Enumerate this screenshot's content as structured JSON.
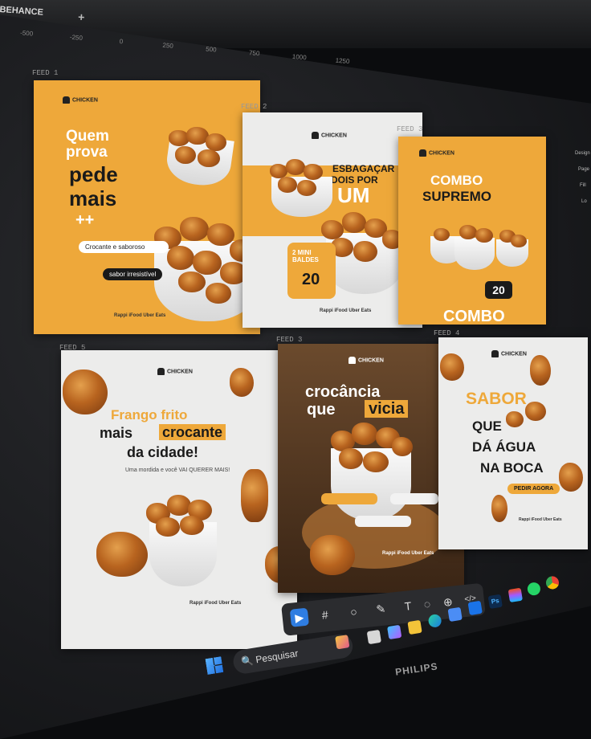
{
  "app": {
    "tab_title": "BEHANCE",
    "new_tab": "+"
  },
  "ruler": {
    "ticks": [
      "-500",
      "-250",
      "0",
      "250",
      "500",
      "750",
      "1000",
      "1250"
    ]
  },
  "frames": {
    "feed1": {
      "label": "FEED 1",
      "brand": "CHICKEN",
      "line1": "Quem",
      "line2": "prova",
      "line3": "pede",
      "line4": "mais",
      "plus": "++",
      "pill1": "Crocante e saboroso",
      "pill2": "sabor irresistível",
      "delivery": "Rappi  iFood  Uber Eats"
    },
    "feed2": {
      "label": "FEED 2",
      "brand": "CHICKEN",
      "line1": "ESBAGAÇAR",
      "line2": "DOIS POR",
      "line3": "UM",
      "offer_title": "2 MINI BALDES",
      "price": "20",
      "delivery": "Rappi  iFood  Uber Eats"
    },
    "feed3a": {
      "label": "FEED 3",
      "brand": "CHICKEN",
      "line1": "COMBO",
      "line2": "SUPREMO",
      "price": "20",
      "bottom": "COMBO"
    },
    "feed5": {
      "label": "FEED 5",
      "brand": "CHICKEN",
      "line1": "Frango frito",
      "line2a": "mais",
      "line2b": "crocante",
      "line3": "da cidade!",
      "sub": "Uma mordida e você VAI QUERER MAIS!",
      "delivery": "Rappi  iFood  Uber Eats"
    },
    "feed3b": {
      "label": "FEED 3",
      "brand": "CHICKEN",
      "line1": "crocância",
      "line2a": "que",
      "line2b": "vicia",
      "delivery": "Rappi  iFood  Uber Eats"
    },
    "feed4": {
      "label": "FEED 4",
      "brand": "CHICKEN",
      "line1": "SABOR",
      "line2": "QUE",
      "line3": "DÁ ÁGUA",
      "line4": "NA BOCA",
      "button": "PEDIR AGORA",
      "delivery": "Rappi  iFood  Uber Eats"
    }
  },
  "right_panel": {
    "items": [
      "Design",
      "Page",
      "Fill",
      "Lo"
    ]
  },
  "toolbar": {
    "tools": [
      "▶",
      "#",
      "○",
      "✎",
      "T",
      "◌",
      "⊕",
      "</>"
    ]
  },
  "taskbar": {
    "search_placeholder": "Pesquisar"
  },
  "monitor": {
    "brand": "PHILIPS"
  },
  "colors": {
    "accent": "#eea83a",
    "dark": "#1b1c1f",
    "select": "#2f7de1"
  }
}
